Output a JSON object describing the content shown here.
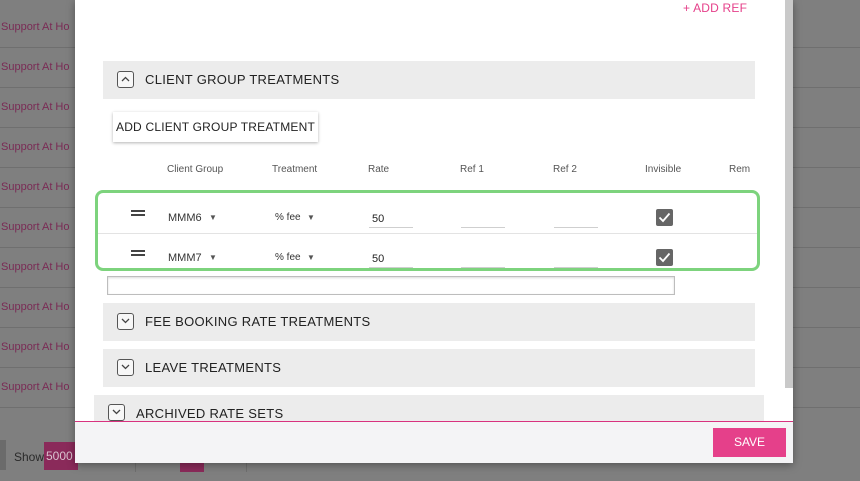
{
  "background": {
    "row_text": "Support At Ho",
    "rows": 10,
    "show_label": "Show",
    "show_value": "5000"
  },
  "modal": {
    "add_ref_link": "+ ADD REF",
    "sections": {
      "client_group": "CLIENT GROUP TREATMENTS",
      "fee_booking": "FEE BOOKING RATE TREATMENTS",
      "leave": "LEAVE TREATMENTS",
      "archived": "ARCHIVED RATE SETS"
    },
    "add_client_group_button": "ADD CLIENT GROUP TREATMENT",
    "columns": {
      "client_group": "Client Group",
      "treatment": "Treatment",
      "rate": "Rate",
      "ref1": "Ref 1",
      "ref2": "Ref 2",
      "invisible": "Invisible",
      "remove": "Rem"
    },
    "rows": [
      {
        "client_group": "MMM6",
        "treatment": "% fee",
        "rate": "50",
        "ref1": "",
        "ref2": "",
        "invisible": true
      },
      {
        "client_group": "MMM7",
        "treatment": "% fee",
        "rate": "50",
        "ref1": "",
        "ref2": "",
        "invisible": true
      }
    ],
    "save_button": "SAVE"
  },
  "colors": {
    "accent": "#e5408a",
    "highlight_border": "#7dd37d"
  }
}
